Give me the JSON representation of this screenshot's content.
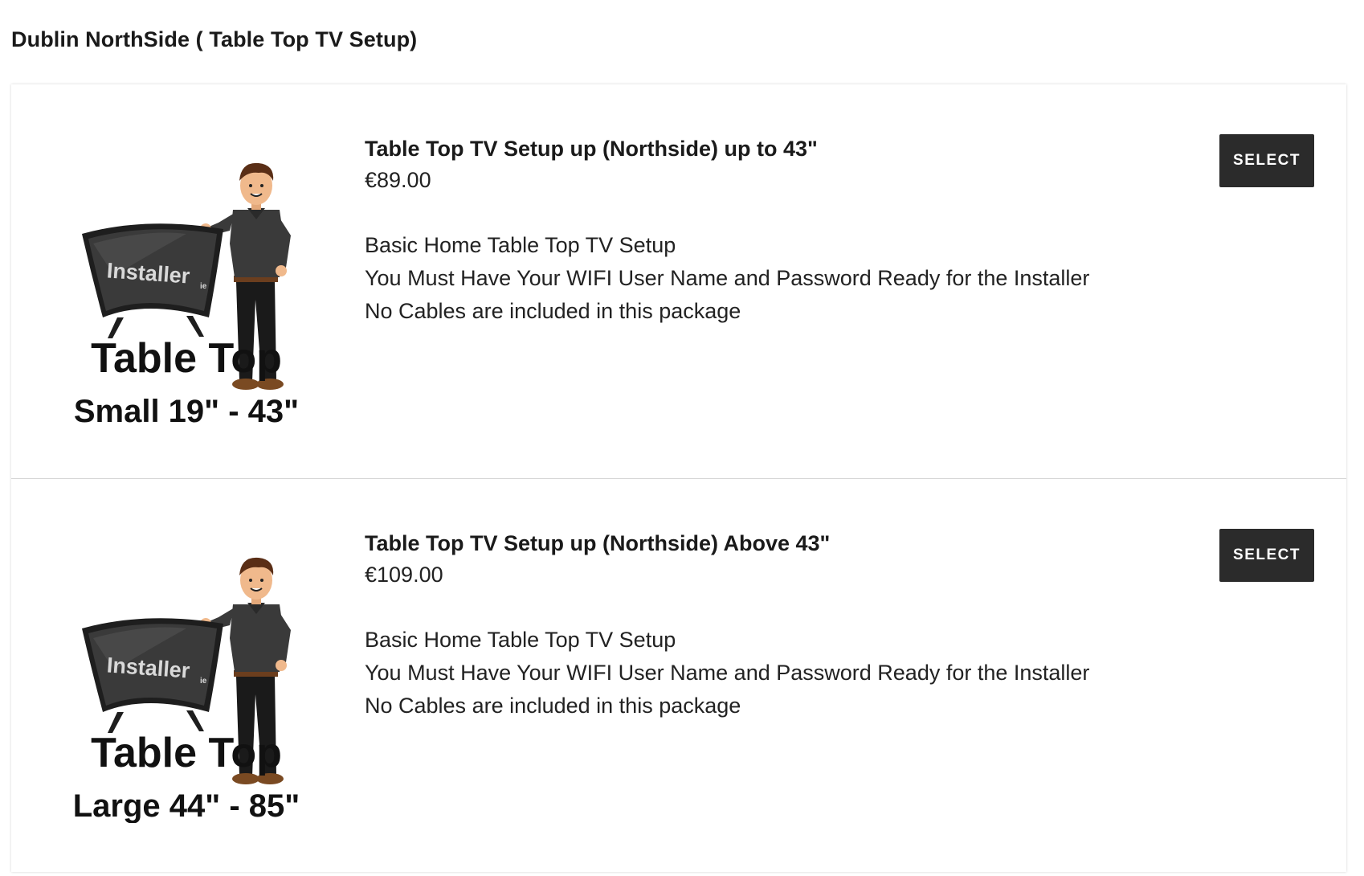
{
  "category": {
    "title": "Dublin NorthSide ( Table Top TV Setup)"
  },
  "services": [
    {
      "name": "Table Top TV Setup up (Northside) up to 43\"",
      "price": "€89.00",
      "description": [
        "Basic Home Table Top TV Setup",
        "You Must Have Your WIFI User Name and Password Ready for the Installer",
        "No Cables are included in this package"
      ],
      "button_label": "SELECT",
      "image": {
        "logo_text": "Installer",
        "logo_suffix": "ie",
        "line1": "Table Top",
        "line2": "Small 19\" - 43\""
      }
    },
    {
      "name": "Table Top TV Setup up (Northside) Above 43\"",
      "price": "€109.00",
      "description": [
        "Basic Home Table Top TV Setup",
        "You Must Have Your WIFI User Name and Password Ready for the Installer",
        "No Cables are included in this package"
      ],
      "button_label": "SELECT",
      "image": {
        "logo_text": "Installer",
        "logo_suffix": "ie",
        "line1": "Table Top",
        "line2": "Large 44\" - 85\""
      }
    }
  ],
  "colors": {
    "button_bg": "#2b2b2b",
    "button_text": "#ffffff",
    "tv_dark": "#1e1e1e",
    "shirt": "#3a3a3a",
    "skin": "#f0b98c",
    "hair": "#5a2e16"
  }
}
